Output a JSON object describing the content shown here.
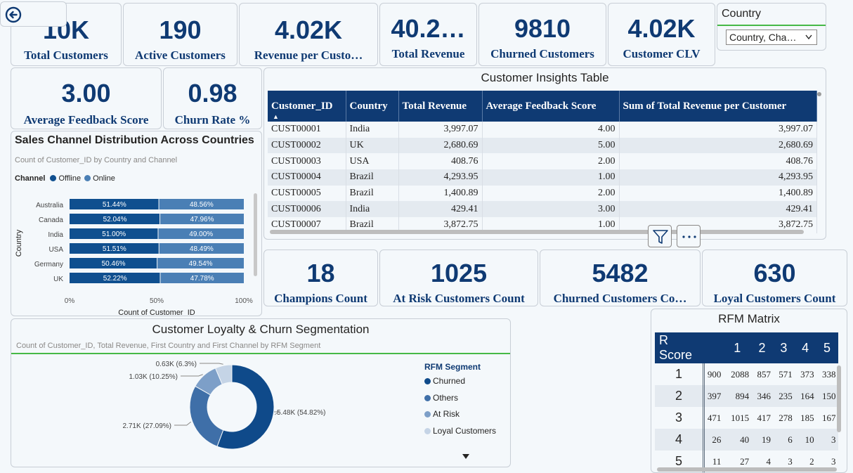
{
  "kpis_top": [
    {
      "value": "10K",
      "label": "Total Customers"
    },
    {
      "value": "190",
      "label": "Active Customers"
    },
    {
      "value": "4.02K",
      "label": "Revenue per Custo…"
    },
    {
      "value": "40.2…",
      "label": "Total Revenue"
    },
    {
      "value": "9810",
      "label": "Churned Customers"
    },
    {
      "value": "4.02K",
      "label": "Customer CLV"
    }
  ],
  "kpis_mid": [
    {
      "value": "3.00",
      "label": "Average Feedback Score"
    },
    {
      "value": "0.98",
      "label": "Churn Rate %"
    }
  ],
  "kpis_rfm": [
    {
      "value": "18",
      "label": "Champions Count"
    },
    {
      "value": "1025",
      "label": "At Risk Customers Count"
    },
    {
      "value": "5482",
      "label": "Churned Customers Co…"
    },
    {
      "value": "630",
      "label": "Loyal Customers Count"
    }
  ],
  "slicer": {
    "title": "Country",
    "value": "Country, Cha…"
  },
  "sales_channel": {
    "title": "Sales Channel Distribution Across Countries",
    "subtitle": "Count of Customer_ID by Country and Channel",
    "legend_title": "Channel",
    "xlabel": "Count of Customer_ID",
    "ylabel": "Country"
  },
  "insights_table": {
    "title": "Customer Insights Table",
    "columns": [
      "Customer_ID",
      "Country",
      "Total Revenue",
      "Average Feedback Score",
      "Sum of Total Revenue per Customer"
    ],
    "rows": [
      [
        "CUST00001",
        "India",
        "3,997.07",
        "4.00",
        "3,997.07"
      ],
      [
        "CUST00002",
        "UK",
        "2,680.69",
        "5.00",
        "2,680.69"
      ],
      [
        "CUST00003",
        "USA",
        "408.76",
        "2.00",
        "408.76"
      ],
      [
        "CUST00004",
        "Brazil",
        "4,293.95",
        "1.00",
        "4,293.95"
      ],
      [
        "CUST00005",
        "Brazil",
        "1,400.89",
        "2.00",
        "1,400.89"
      ],
      [
        "CUST00006",
        "India",
        "429.41",
        "3.00",
        "429.41"
      ],
      [
        "CUST00007",
        "Brazil",
        "3,872.75",
        "1.00",
        "3,872.75"
      ]
    ]
  },
  "loyalty": {
    "title": "Customer Loyalty & Churn Segmentation",
    "subtitle": "Count of Customer_ID, Total Revenue, First Country and First Channel by RFM Segment",
    "legend_title": "RFM Segment"
  },
  "rfm_matrix": {
    "title": "RFM Matrix",
    "header": [
      "R Score",
      "1",
      "2",
      "3",
      "4",
      "5"
    ],
    "rows": [
      [
        "1",
        "900",
        "2088",
        "857",
        "571",
        "373",
        "338"
      ],
      [
        "2",
        "397",
        "894",
        "346",
        "235",
        "164",
        "150"
      ],
      [
        "3",
        "471",
        "1015",
        "417",
        "278",
        "185",
        "167"
      ],
      [
        "4",
        "26",
        "40",
        "19",
        "6",
        "10",
        "3"
      ],
      [
        "5",
        "11",
        "27",
        "4",
        "3",
        "2",
        "3"
      ]
    ]
  },
  "colors": {
    "accent": "#0f3a73",
    "green": "#46b946",
    "bar_offline": "#0f4f8f",
    "bar_online": "#4a7fb5"
  },
  "chart_data": [
    {
      "type": "bar",
      "orientation": "horizontal-stacked-100",
      "categories": [
        "Australia",
        "Canada",
        "India",
        "USA",
        "Germany",
        "UK"
      ],
      "series": [
        {
          "name": "Offline",
          "values": [
            51.44,
            52.04,
            51.0,
            51.51,
            50.46,
            52.22
          ],
          "labels": [
            "51.44%",
            "52.04%",
            "51.00%",
            "51.51%",
            "50.46%",
            "52.22%"
          ],
          "color": "#0f4f8f"
        },
        {
          "name": "Online",
          "values": [
            48.56,
            47.96,
            49.0,
            48.49,
            49.54,
            47.78
          ],
          "labels": [
            "48.56%",
            "47.96%",
            "49.00%",
            "48.49%",
            "49.54%",
            "47.78%"
          ],
          "color": "#4a7fb5"
        }
      ],
      "xticks": [
        "0%",
        "50%",
        "100%"
      ],
      "xlim": [
        0,
        100
      ]
    },
    {
      "type": "pie",
      "donut": true,
      "slices": [
        {
          "name": "Churned",
          "value": 54.82,
          "label": "5.48K (54.82%)",
          "color": "#0f4a8a"
        },
        {
          "name": "Others",
          "value": 27.09,
          "label": "2.71K (27.09%)",
          "color": "#3f6fa8"
        },
        {
          "name": "At Risk",
          "value": 10.25,
          "label": "1.03K (10.25%)",
          "color": "#7d9fc8"
        },
        {
          "name": "Loyal Customers",
          "value": 6.3,
          "label": "0.63K (6.3%)",
          "color": "#c5d4e6"
        }
      ]
    }
  ]
}
